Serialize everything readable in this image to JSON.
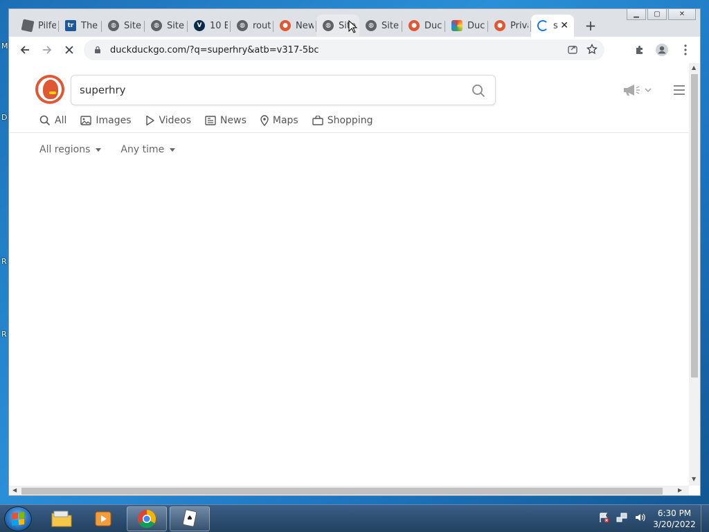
{
  "desktop": {
    "edge_letters": [
      "M",
      "D",
      "R",
      "R"
    ]
  },
  "browser": {
    "tabs": [
      {
        "label": "Pilfe",
        "icon": "roblox-icon"
      },
      {
        "label": "The",
        "icon": "tr-icon"
      },
      {
        "label": "Site",
        "icon": "globe-icon"
      },
      {
        "label": "Site",
        "icon": "globe-icon"
      },
      {
        "label": "10 E",
        "icon": "vc-icon"
      },
      {
        "label": "rout",
        "icon": "globe-icon"
      },
      {
        "label": "New",
        "icon": "duckduckgo-icon"
      },
      {
        "label": "Site",
        "icon": "globe-icon"
      },
      {
        "label": "Site",
        "icon": "globe-icon"
      },
      {
        "label": "Duc",
        "icon": "duckduckgo-icon"
      },
      {
        "label": "Duc",
        "icon": "rainbow-icon"
      },
      {
        "label": "Priva",
        "icon": "duckduckgo-icon"
      },
      {
        "label": "s",
        "icon": "loading-spinner-icon",
        "active": true
      }
    ],
    "new_tab_label": "+",
    "close_tab_label": "✕",
    "url": "duckduckgo.com/?q=superhry&atb=v317-5bc"
  },
  "ddg": {
    "query": "superhry",
    "nav": [
      {
        "label": "All",
        "icon": "search-icon"
      },
      {
        "label": "Images",
        "icon": "image-icon"
      },
      {
        "label": "Videos",
        "icon": "play-icon"
      },
      {
        "label": "News",
        "icon": "newspaper-icon"
      },
      {
        "label": "Maps",
        "icon": "map-pin-icon"
      },
      {
        "label": "Shopping",
        "icon": "shopping-bag-icon"
      }
    ],
    "filters": {
      "region": "All regions",
      "time": "Any time"
    }
  },
  "taskbar": {
    "time": "6:30 PM",
    "date": "3/20/2022"
  },
  "colors": {
    "ddg_orange": "#de5833",
    "chrome_frame": "#dee1e6",
    "taskbar": "#2c4c70"
  }
}
